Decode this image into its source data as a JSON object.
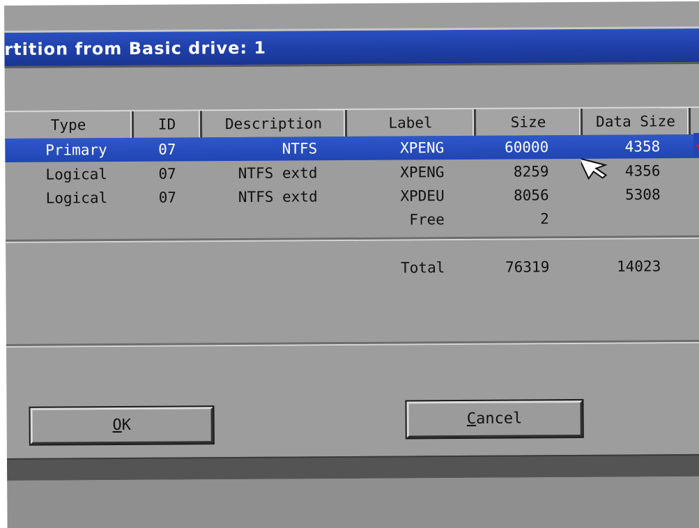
{
  "dialog": {
    "title": "rtition from Basic drive: 1"
  },
  "table": {
    "columns": [
      "Type",
      "ID",
      "Description",
      "Label",
      "Size",
      "Data Size"
    ],
    "rows": [
      {
        "type": "Primary",
        "id": "07",
        "description": "NTFS",
        "label": "XPENG",
        "size": "60000",
        "data_size": "4358",
        "selected": true
      },
      {
        "type": "Logical",
        "id": "07",
        "description": "NTFS extd",
        "label": "XPENG",
        "size": "8259",
        "data_size": "4356",
        "selected": false
      },
      {
        "type": "Logical",
        "id": "07",
        "description": "NTFS extd",
        "label": "XPDEU",
        "size": "8056",
        "data_size": "5308",
        "selected": false
      },
      {
        "type": "",
        "id": "",
        "description": "",
        "label": "Free",
        "size": "2",
        "data_size": "",
        "selected": false
      }
    ],
    "total": {
      "label": "Total",
      "size": "76319",
      "data_size": "14023"
    }
  },
  "buttons": {
    "ok": {
      "mnemonic": "O",
      "rest": "K"
    },
    "cancel": {
      "mnemonic": "C",
      "rest": "ancel"
    }
  },
  "colors": {
    "title_bar": "#2145b4",
    "dialog_bg": "#9d9d9d",
    "selection": "#2145b4",
    "marker": "#e01818"
  },
  "icons": [
    "mouse-pointer-icon",
    "dropdown-marker-icon"
  ]
}
